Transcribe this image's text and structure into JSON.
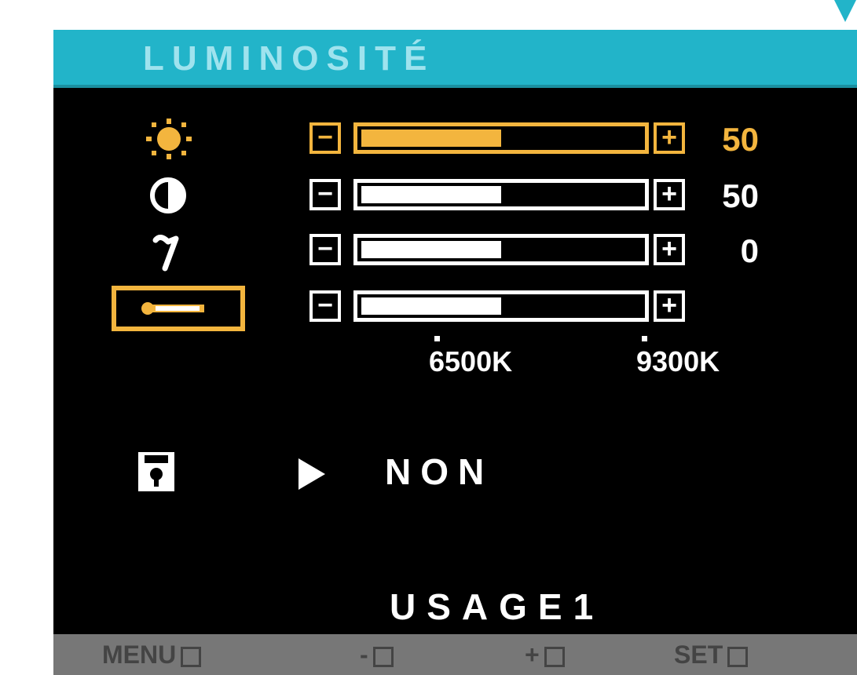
{
  "header": {
    "title": "LUMINOSITÉ"
  },
  "rows": [
    {
      "name": "brightness",
      "icon": "sun-icon",
      "value": "50",
      "level": 0.5,
      "active": true
    },
    {
      "name": "contrast",
      "icon": "contrast-icon",
      "value": "50",
      "level": 0.5,
      "active": false
    },
    {
      "name": "gamma",
      "icon": "gamma-icon",
      "value": "0",
      "level": 0.5,
      "active": false
    },
    {
      "name": "color-temperature",
      "icon": "thermometer-icon",
      "value": "",
      "level": 0.5,
      "active": false
    }
  ],
  "temperature": {
    "labels": [
      "6500K",
      "9300K"
    ]
  },
  "reset": {
    "icon": "save-recall-icon",
    "value": "NON"
  },
  "mode": {
    "label": "USAGE1"
  },
  "footer": {
    "menu": "MENU",
    "minus": "-",
    "plus": "+",
    "set": "SET"
  },
  "colors": {
    "accent": "#f3b53e",
    "title_bar": "#22b4c9",
    "bottom_bar": "#777777"
  }
}
